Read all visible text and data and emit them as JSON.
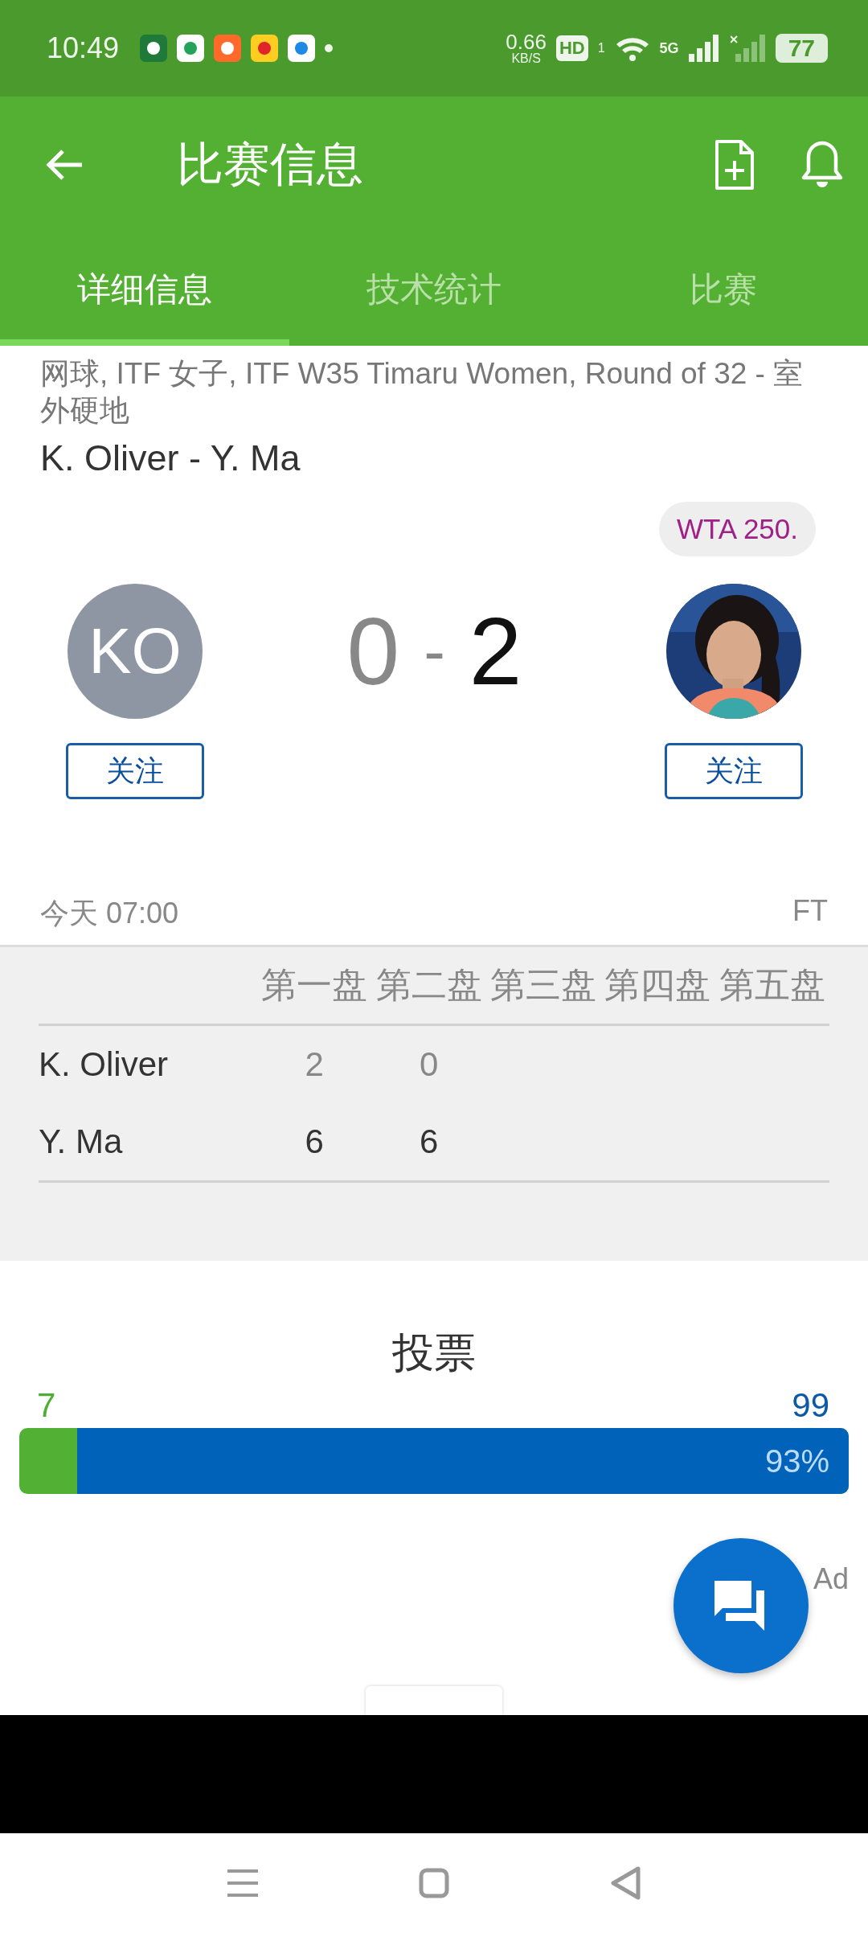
{
  "status_bar": {
    "time": "10:49",
    "net_speed": "0.66",
    "net_unit": "KB/S",
    "hd": "HD",
    "hd_sub": "1",
    "network": "5G",
    "battery": "77"
  },
  "header": {
    "title": "比赛信息"
  },
  "tabs": [
    {
      "label": "详细信息",
      "selected": true
    },
    {
      "label": "技术统计",
      "selected": false
    },
    {
      "label": "比赛",
      "selected": false
    }
  ],
  "match": {
    "competition": "网球, ITF 女子, ITF W35 Timaru Women, Round of 32 - 室外硬地",
    "title": "K. Oliver - Y. Ma",
    "badge": "WTA 250.",
    "separator": "-",
    "players": [
      {
        "kind": "initials",
        "initials": "KO",
        "follow": "关注",
        "score": "0",
        "winner": false
      },
      {
        "kind": "picture",
        "follow": "关注",
        "score": "2",
        "winner": true
      }
    ],
    "time": "今天 07:00",
    "status": "FT"
  },
  "sets": {
    "columns": [
      "第一盘",
      "第二盘",
      "第三盘",
      "第四盘",
      "第五盘"
    ],
    "rows": [
      {
        "player": "K. Oliver",
        "scores": [
          "2",
          "0"
        ],
        "winner": false
      },
      {
        "player": "Y. Ma",
        "scores": [
          "6",
          "6"
        ],
        "winner": true
      }
    ]
  },
  "vote": {
    "title": "投票",
    "home_count": "7",
    "away_count": "99",
    "level": 0.93,
    "percent": "93%"
  },
  "ad_label": "Ad"
}
